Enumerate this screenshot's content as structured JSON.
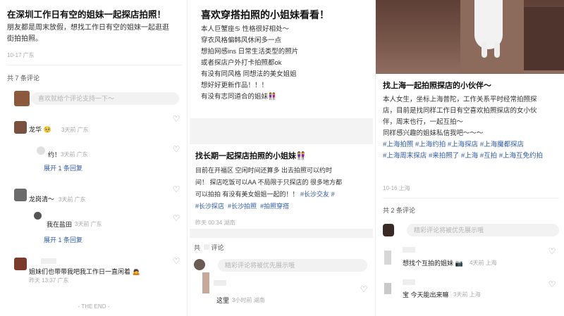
{
  "panel1": {
    "title": "在深圳工作日有空的姐妹一起探店拍照！",
    "body_line1": "朋友都是周末放假，想找工作日有空的姐妹一起逛逛",
    "body_line2": "街拍拍照。",
    "post_meta": "10-17 广东",
    "comment_count": "共 7 条评论",
    "input_placeholder": "喜欢就给个评论支持一下～",
    "comments": [
      {
        "name": "龙华",
        "emoji": "🥺",
        "meta": "3天前 广东"
      },
      {
        "text": "约！",
        "meta": "3天前 广东"
      },
      {
        "expand": "展开 1 条回复"
      },
      {
        "name": "龙岗清～",
        "meta": "3天前 广东"
      },
      {
        "text": "我在盐田",
        "meta": "3天前 广东"
      },
      {
        "expand": "展开 1 条回复"
      },
      {
        "text": "姐妹们也带带我吧我工作日一直闲着",
        "emoji": "🙇",
        "meta": "昨天 13:37 广东"
      }
    ],
    "end_text": "- THE END -"
  },
  "panel2": {
    "title": "喜欢穿搭拍照的小姐妹看看！",
    "body_lines": [
      "本人巨蟹座♋ 性格很好相处～",
      "穿衣风格偏韩风休闲多一点",
      "想拍网感ins 日常生活类型的照片",
      "或者探店户外打卡拍照都ok",
      "有没有同风格 同想法的美女姐姐",
      "想好好更新作品！！！",
      "有没有志同道合的姐妹👭"
    ],
    "title2": "找长期一起探店拍照的小姐妹👭",
    "body2_line1": "目前在开福区 空闲时间还算多 出去拍照可以约时",
    "body2_line2": "间！ 探店吃饭可以AA 不局限于只探店的 很多地方都",
    "body2_line3": "可以拍拍 有没有美女姐姐一起的！！",
    "tags2": [
      "#长沙交友",
      "#长沙探店",
      "#长沙拍照",
      "#拍照穿搭"
    ],
    "post_meta": "昨天 00:34 湖南",
    "comment_count": "评论",
    "input_placeholder": "精彩评论将被优先展示哦",
    "comment_text": "这里",
    "comment_meta": "3小时前 湖南"
  },
  "panel3": {
    "title": "找上海一起拍照探店的小伙伴～",
    "body_line1": "本人女生，坐标上海普陀，工作关系平时经常拍照探",
    "body_line2": "店，目前是找同样工作日有空喜欢拍照探店的女小伙",
    "body_line3": "伴，周末也行，一起互拍～",
    "body_line4": "同样感兴趣的姐妹私信我吧～～～",
    "tags": [
      "#上海拍照",
      "#上海约拍",
      "#上海探店",
      "#上海魔都探店",
      "#上海周末探店",
      "#来拍照了",
      "#上海",
      "#互拍",
      "#上海互免约拍"
    ],
    "post_meta": "10-16 上海",
    "comment_count": "共 2 条评论",
    "input_placeholder": "精彩评论将被优先展示哦",
    "comment1_text": "想找个互拍的姐妹",
    "comment1_emoji": "📷",
    "comment1_meta": "4天前 上海",
    "comment2_text": "宝 今天能出来嘛",
    "comment2_meta": "3天前 上海"
  }
}
